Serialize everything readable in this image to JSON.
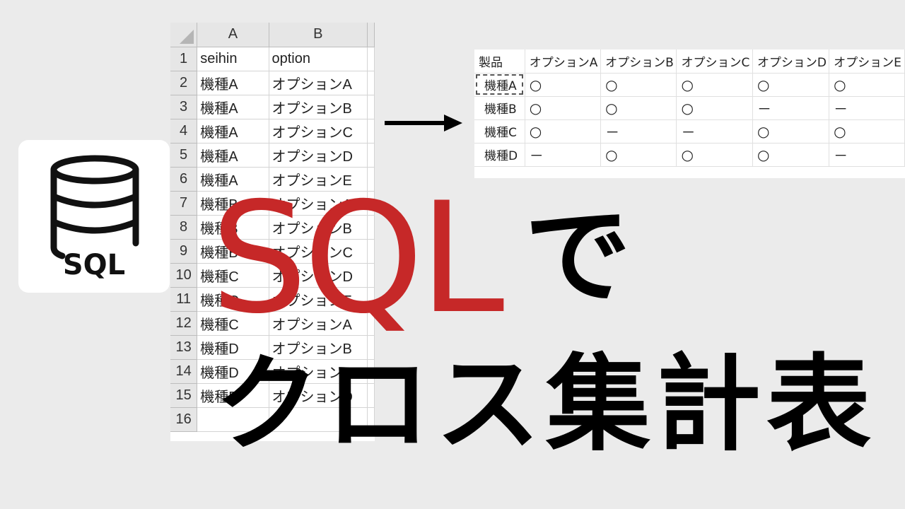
{
  "logo": {
    "icon": "database-icon",
    "text": "SQL"
  },
  "sheet": {
    "columns": [
      "A",
      "B"
    ],
    "rows": [
      {
        "n": "1",
        "a": "seihin",
        "b": "option"
      },
      {
        "n": "2",
        "a": "機種A",
        "b": "オプションA"
      },
      {
        "n": "3",
        "a": "機種A",
        "b": "オプションB"
      },
      {
        "n": "4",
        "a": "機種A",
        "b": "オプションC"
      },
      {
        "n": "5",
        "a": "機種A",
        "b": "オプションD"
      },
      {
        "n": "6",
        "a": "機種A",
        "b": "オプションE"
      },
      {
        "n": "7",
        "a": "機種B",
        "b": "オプションA"
      },
      {
        "n": "8",
        "a": "機種B",
        "b": "オプションB"
      },
      {
        "n": "9",
        "a": "機種B",
        "b": "オプションC"
      },
      {
        "n": "10",
        "a": "機種C",
        "b": "オプションD"
      },
      {
        "n": "11",
        "a": "機種C",
        "b": "オプションE"
      },
      {
        "n": "12",
        "a": "機種C",
        "b": "オプションA"
      },
      {
        "n": "13",
        "a": "機種D",
        "b": "オプションB"
      },
      {
        "n": "14",
        "a": "機種D",
        "b": "オプションC"
      },
      {
        "n": "15",
        "a": "機種D",
        "b": "オプションD"
      },
      {
        "n": "16",
        "a": "",
        "b": ""
      }
    ]
  },
  "cross": {
    "header": [
      "製品",
      "オプションA",
      "オプションB",
      "オプションC",
      "オプションD",
      "オプションE"
    ],
    "rows": [
      [
        "機種A",
        "○",
        "○",
        "○",
        "○",
        "○"
      ],
      [
        "機種B",
        "○",
        "○",
        "○",
        "－",
        "－"
      ],
      [
        "機種C",
        "○",
        "－",
        "－",
        "○",
        "○"
      ],
      [
        "機種D",
        "－",
        "○",
        "○",
        "○",
        "－"
      ]
    ]
  },
  "headline": {
    "sql": "SQL",
    "de": "で",
    "line2": "クロス集計表"
  },
  "colors": {
    "accent": "#c62828",
    "background": "#ebebeb"
  }
}
